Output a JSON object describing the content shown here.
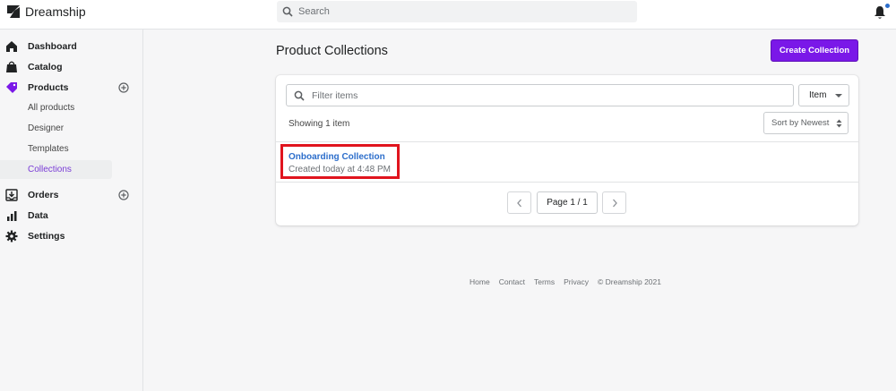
{
  "app": {
    "name": "Dreamship"
  },
  "search": {
    "placeholder": "Search"
  },
  "sidebar": {
    "items": [
      {
        "label": "Dashboard"
      },
      {
        "label": "Catalog"
      },
      {
        "label": "Products"
      },
      {
        "label": "All products"
      },
      {
        "label": "Designer"
      },
      {
        "label": "Templates"
      },
      {
        "label": "Collections"
      },
      {
        "label": "Orders"
      },
      {
        "label": "Data"
      },
      {
        "label": "Settings"
      }
    ]
  },
  "main": {
    "title": "Product Collections",
    "create_label": "Create Collection",
    "filter_placeholder": "Filter items",
    "item_dropdown": "Item",
    "showing": "Showing 1 item",
    "sort_label": "Sort by Newest",
    "collections": [
      {
        "name": "Onboarding Collection",
        "created": "Created today at 4:48 PM"
      }
    ],
    "page_label": "Page 1 / 1"
  },
  "footer": {
    "links": [
      "Home",
      "Contact",
      "Terms",
      "Privacy",
      "© Dreamship 2021"
    ]
  },
  "colors": {
    "accent": "#7a18e8",
    "link": "#2c6ecb",
    "active_nav": "#7a3cd6",
    "highlight_box": "#e0141e"
  }
}
